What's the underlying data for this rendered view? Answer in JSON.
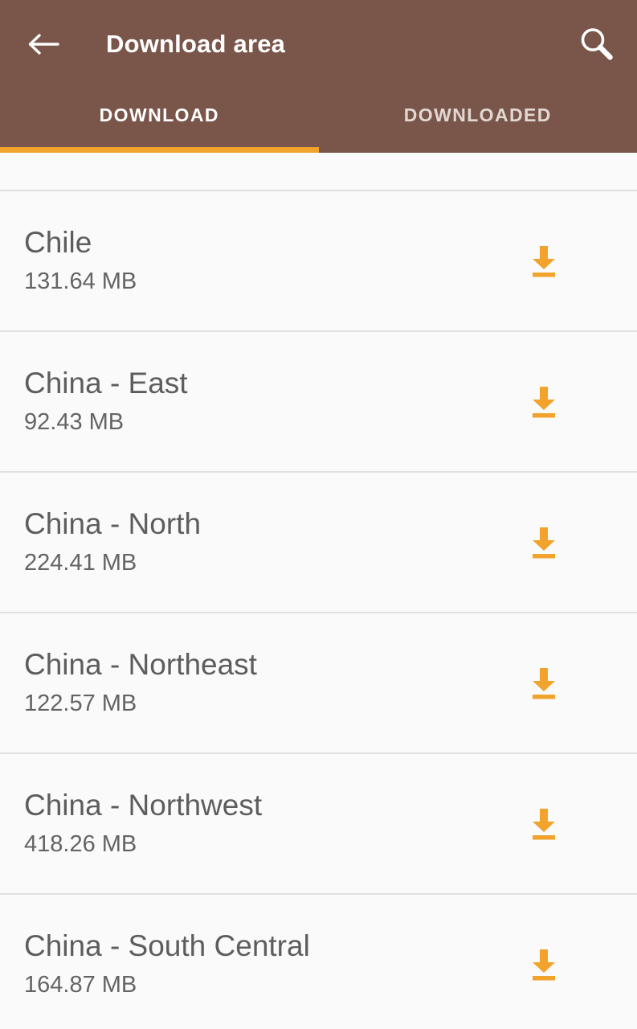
{
  "appbar": {
    "title": "Download area",
    "back_icon": "arrow-left-icon",
    "search_icon": "search-icon",
    "background_color": "#7a564a",
    "title_color": "#ffffff"
  },
  "tabs": {
    "items": [
      {
        "label": "DOWNLOAD",
        "active": true
      },
      {
        "label": "DOWNLOADED",
        "active": false
      }
    ],
    "indicator_color": "#f2a32b",
    "active_text_color": "#ffffff",
    "inactive_text_color": "#e2d8d3"
  },
  "list": {
    "download_icon": "download-icon",
    "download_icon_color": "#f2a32b",
    "divider_color": "#e0e0e0",
    "background_color": "#fafafa",
    "name_color": "#5d5d5d",
    "size_color": "#646464",
    "items": [
      {
        "name": "Chile",
        "size": "131.64 MB"
      },
      {
        "name": "China - East",
        "size": "92.43 MB"
      },
      {
        "name": "China - North",
        "size": "224.41 MB"
      },
      {
        "name": "China - Northeast",
        "size": "122.57 MB"
      },
      {
        "name": "China - Northwest",
        "size": "418.26 MB"
      },
      {
        "name": "China - South Central",
        "size": "164.87 MB"
      }
    ]
  }
}
